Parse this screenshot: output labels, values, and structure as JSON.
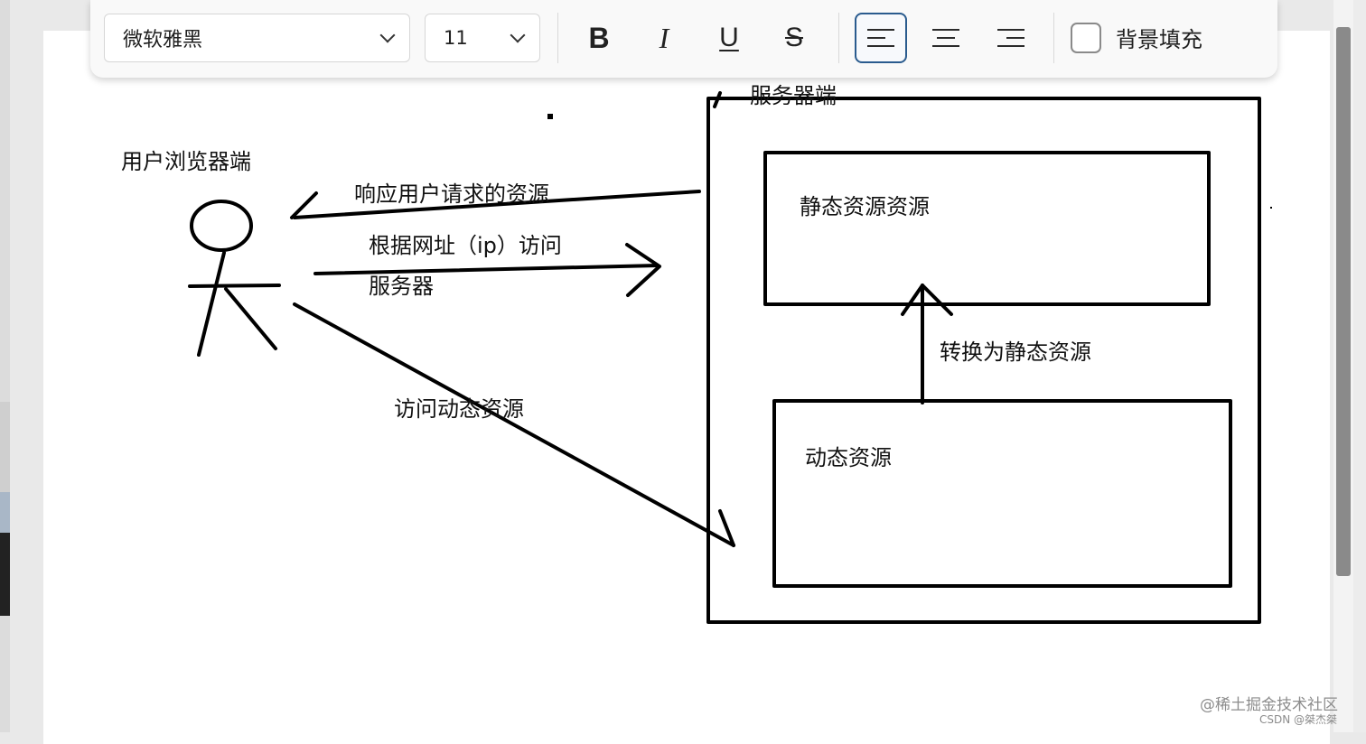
{
  "toolbar": {
    "font_family": "微软雅黑",
    "font_size": "11",
    "bold_label": "B",
    "italic_label": "I",
    "underline_label": "U",
    "strikethrough_label": "S",
    "background_fill_label": "背景填充",
    "background_fill_checked": false,
    "active_alignment": "left"
  },
  "diagram": {
    "server_label": "服务器端",
    "browser_label": "用户浏览器端",
    "response_label": "响应用户请求的资源",
    "request_label_line1": "根据网址（ip）访问",
    "request_label_line2": "服务器",
    "dynamic_access_label": "访问动态资源",
    "static_box_label": "静态资源资源",
    "convert_label": "转换为静态资源",
    "dynamic_box_label": "动态资源"
  },
  "watermark": {
    "line1": "@稀土掘金技术社区",
    "line2": "CSDN @桀杰桀"
  }
}
